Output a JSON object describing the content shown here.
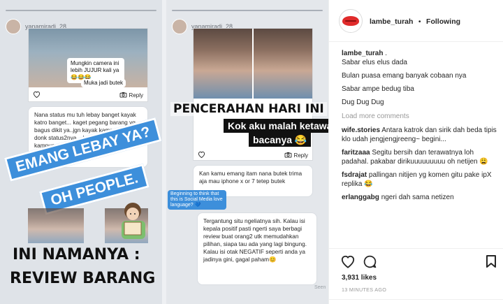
{
  "post": {
    "username": "lambe_turah",
    "separator": "•",
    "follow_status": "Following",
    "caption_user": "lambe_turah",
    "caption_lines": [
      ".",
      "Sabar elus elus dada",
      "Bulan puasa emang banyak cobaan nya",
      "Sabar ampe bedug tiba",
      "Dug Dug Dug"
    ],
    "load_more": "Load more comments",
    "comments": [
      {
        "user": "wife.stories",
        "text": "Antara katrok dan sirik dah beda tipis klo udah jengjengjreeng~ begini..."
      },
      {
        "user": "faritzaaa",
        "text": "Segitu bersih dan terawatnya loh padahal. pakabar dirikuuuuuuuuu oh netijen 😩"
      },
      {
        "user": "fsdrajat",
        "text": "pallingan nitijen yg komen gitu pake ipX replika 😂"
      },
      {
        "user": "erlanggabg",
        "text": "ngeri dah sama netizen"
      }
    ],
    "likes": "3,931 likes",
    "time": "13 MINUTES AGO"
  },
  "stories": {
    "left": {
      "username": "yanamiradi_28",
      "camera_caption": "Mungkin camera ini lebih JUJUR kali ya 😂😂😂",
      "camera_caption_2": "Muka jadi butek",
      "reply_label": "Reply",
      "comment": "Nana status mu tuh lebay banget kayak katro banget... kaget pegang barang yg bagus dikit ya..jgn kayak kampungan gitu donk status2nya ...keliatan banget kampungannya iphone x aja di statusin",
      "sticker_line1": "EMANG LEBAY YA?",
      "sticker_line2": "OH PEOPLE.",
      "headline_line1": "INI NAMANYA :",
      "headline_line2": "REVIEW BARANG"
    },
    "right": {
      "username": "yanamiradi_28",
      "headline": "PENCERAHAN HARI INI",
      "label_line1": "Kok aku malah ketawa",
      "label_line2": "bacanya 😂",
      "dash": "- X -",
      "reply_label": "Reply",
      "comment1": "Kan kamu emang itam nana butek trima aja mau iphone x or 7 tetep butek",
      "mini_sticker": "Beginning to think that this is Social Media love language? 💙",
      "comment2": "Tergantung situ ngeliatnya sih. Kalau isi kepala positif pasti ngerti saya berbagi review buat orang2 utk memudahkan pilihan, siapa tau ada yang lagi bingung. Kalau isi otak NEGATIF seperti anda ya jadinya gini, gagal paham😊",
      "seen_label": "Seen"
    }
  },
  "colors": {
    "sticker_blue": "#3d8fdb",
    "logo_red": "#e02b2b",
    "muted_text": "#999999"
  },
  "icons": [
    "heart-icon",
    "comment-icon",
    "bookmark-icon",
    "camera-icon",
    "sparkle-icon"
  ]
}
